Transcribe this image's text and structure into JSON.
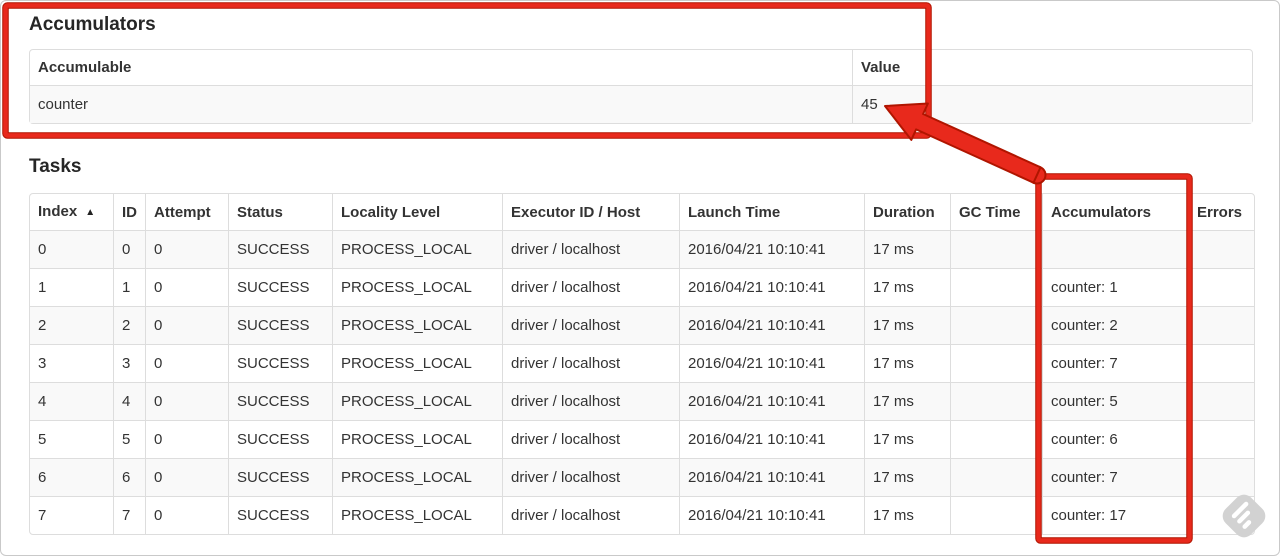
{
  "theme": {
    "annotation_red": "#e8291c",
    "annotation_red_dark": "#b01500",
    "table_border": "#dddddd",
    "stripe_bg": "#f9f9f9",
    "text_color": "#333333",
    "watermark_gray": "#d2d2d2"
  },
  "accumulators_section": {
    "heading": "Accumulators",
    "table": {
      "headers": [
        "Accumulable",
        "Value"
      ],
      "rows": [
        [
          "counter",
          "45"
        ]
      ]
    }
  },
  "tasks_section": {
    "heading": "Tasks",
    "table": {
      "sort_column": 0,
      "sort_arrow": "▲",
      "headers": [
        "Index",
        "ID",
        "Attempt",
        "Status",
        "Locality Level",
        "Executor ID / Host",
        "Launch Time",
        "Duration",
        "GC Time",
        "Accumulators",
        "Errors"
      ],
      "rows": [
        [
          "0",
          "0",
          "0",
          "SUCCESS",
          "PROCESS_LOCAL",
          "driver / localhost",
          "2016/04/21 10:10:41",
          "17 ms",
          "",
          "",
          ""
        ],
        [
          "1",
          "1",
          "0",
          "SUCCESS",
          "PROCESS_LOCAL",
          "driver / localhost",
          "2016/04/21 10:10:41",
          "17 ms",
          "",
          "counter: 1",
          ""
        ],
        [
          "2",
          "2",
          "0",
          "SUCCESS",
          "PROCESS_LOCAL",
          "driver / localhost",
          "2016/04/21 10:10:41",
          "17 ms",
          "",
          "counter: 2",
          ""
        ],
        [
          "3",
          "3",
          "0",
          "SUCCESS",
          "PROCESS_LOCAL",
          "driver / localhost",
          "2016/04/21 10:10:41",
          "17 ms",
          "",
          "counter: 7",
          ""
        ],
        [
          "4",
          "4",
          "0",
          "SUCCESS",
          "PROCESS_LOCAL",
          "driver / localhost",
          "2016/04/21 10:10:41",
          "17 ms",
          "",
          "counter: 5",
          ""
        ],
        [
          "5",
          "5",
          "0",
          "SUCCESS",
          "PROCESS_LOCAL",
          "driver / localhost",
          "2016/04/21 10:10:41",
          "17 ms",
          "",
          "counter: 6",
          ""
        ],
        [
          "6",
          "6",
          "0",
          "SUCCESS",
          "PROCESS_LOCAL",
          "driver / localhost",
          "2016/04/21 10:10:41",
          "17 ms",
          "",
          "counter: 7",
          ""
        ],
        [
          "7",
          "7",
          "0",
          "SUCCESS",
          "PROCESS_LOCAL",
          "driver / localhost",
          "2016/04/21 10:10:41",
          "17 ms",
          "",
          "counter: 17",
          ""
        ]
      ]
    }
  },
  "annotations": {
    "highlight_color": "#e8291c"
  }
}
